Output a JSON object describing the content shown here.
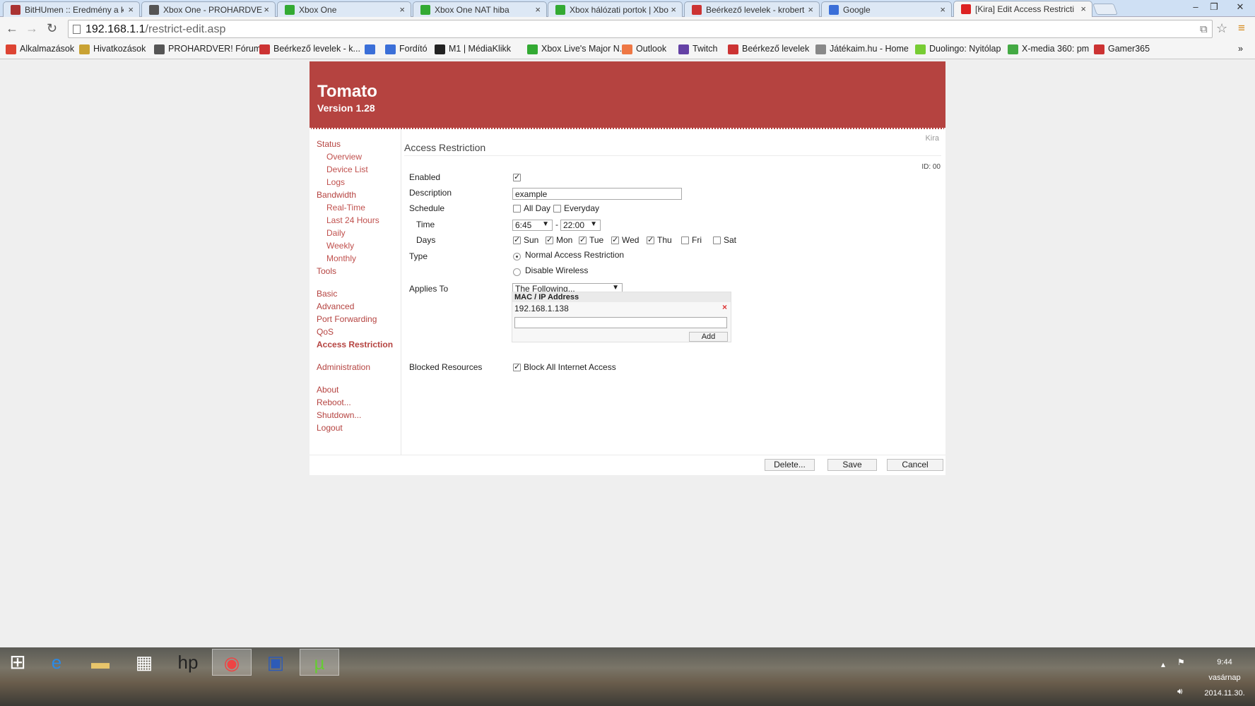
{
  "browser": {
    "tabs": [
      {
        "title": "BitHUmen :: Eredmény a k",
        "favicon": "bithumen-icon",
        "color": "#a33"
      },
      {
        "title": "Xbox One - PROHARDVER!",
        "favicon": "prohardver-icon",
        "color": "#555"
      },
      {
        "title": "Xbox One",
        "favicon": "xbox-icon",
        "color": "#3a3"
      },
      {
        "title": "Xbox One NAT hiba",
        "favicon": "xbox-icon",
        "color": "#3a3"
      },
      {
        "title": "Xbox hálózati portok | Xbo",
        "favicon": "xbox-icon",
        "color": "#3a3"
      },
      {
        "title": "Beérkező levelek - krobert",
        "favicon": "gmail-icon",
        "color": "#c33"
      },
      {
        "title": "Google",
        "favicon": "google-icon",
        "color": "#3b6fd8"
      },
      {
        "title": "[Kira] Edit Access Restricti",
        "favicon": "tomato-icon",
        "color": "#d22"
      }
    ],
    "address": {
      "host": "192.168.1.1",
      "path": "/restrict-edit.asp"
    },
    "bookmarks": [
      {
        "label": "Alkalmazások",
        "icon": "apps-grid-icon",
        "color": "#d43"
      },
      {
        "label": "Hivatkozások",
        "icon": "folder-icon",
        "color": "#c9a233"
      },
      {
        "label": "PROHARDVER! Fórum",
        "icon": "prohardver-icon",
        "color": "#555"
      },
      {
        "label": "Beérkező levelek - k...",
        "icon": "gmail-icon",
        "color": "#c33"
      },
      {
        "label": "",
        "icon": "google-icon",
        "color": "#3b6fd8"
      },
      {
        "label": "Fordító",
        "icon": "translate-icon",
        "color": "#3b6fd8"
      },
      {
        "label": "M1 | MédiaKlikk",
        "icon": "m1-icon",
        "color": "#222"
      },
      {
        "label": "Xbox Live's Major N...",
        "icon": "xbox-icon",
        "color": "#3a3"
      },
      {
        "label": "Outlook",
        "icon": "outlook-icon",
        "color": "#e74"
      },
      {
        "label": "Twitch",
        "icon": "twitch-icon",
        "color": "#6441a5"
      },
      {
        "label": "Beérkező levelek",
        "icon": "gmail-icon",
        "color": "#c33"
      },
      {
        "label": "Játékaim.hu - Home",
        "icon": "jatekaim-icon",
        "color": "#888"
      },
      {
        "label": "Duolingo: Nyitólap",
        "icon": "duolingo-icon",
        "color": "#7c3"
      },
      {
        "label": "X-media 360: pm",
        "icon": "xmedia-icon",
        "color": "#4a4"
      },
      {
        "label": "Gamer365",
        "icon": "gamer365-icon",
        "color": "#c33"
      }
    ]
  },
  "router": {
    "brand": "Tomato",
    "version": "Version 1.28",
    "accent": "#b54340",
    "username": "Kira",
    "nav": [
      {
        "label": "Status",
        "level": 0
      },
      {
        "label": "Overview",
        "level": 1
      },
      {
        "label": "Device List",
        "level": 1
      },
      {
        "label": "Logs",
        "level": 1
      },
      {
        "label": "Bandwidth",
        "level": 0
      },
      {
        "label": "Real-Time",
        "level": 1
      },
      {
        "label": "Last 24 Hours",
        "level": 1
      },
      {
        "label": "Daily",
        "level": 1
      },
      {
        "label": "Weekly",
        "level": 1
      },
      {
        "label": "Monthly",
        "level": 1
      },
      {
        "label": "Tools",
        "level": 0
      },
      {
        "label": "Basic",
        "level": 0
      },
      {
        "label": "Advanced",
        "level": 0
      },
      {
        "label": "Port Forwarding",
        "level": 0
      },
      {
        "label": "QoS",
        "level": 0
      },
      {
        "label": "Access Restriction",
        "level": 0,
        "active": true
      },
      {
        "label": "Administration",
        "level": 0
      },
      {
        "label": "About",
        "level": 0
      },
      {
        "label": "Reboot...",
        "level": 0
      },
      {
        "label": "Shutdown...",
        "level": 0
      },
      {
        "label": "Logout",
        "level": 0
      }
    ],
    "page_title": "Access Restriction",
    "id_label": "ID: 00",
    "form": {
      "enabled_label": "Enabled",
      "enabled": true,
      "description_label": "Description",
      "description_value": "example",
      "schedule_label": "Schedule",
      "all_day_label": "All Day",
      "all_day": false,
      "everyday_label": "Everyday",
      "everyday": false,
      "time_label": "Time",
      "time_from": "6:45",
      "time_sep": "-",
      "time_to": "22:00",
      "days_label": "Days",
      "days": [
        {
          "label": "Sun",
          "checked": true
        },
        {
          "label": "Mon",
          "checked": true
        },
        {
          "label": "Tue",
          "checked": true
        },
        {
          "label": "Wed",
          "checked": true
        },
        {
          "label": "Thu",
          "checked": true
        },
        {
          "label": "Fri",
          "checked": false
        },
        {
          "label": "Sat",
          "checked": false
        }
      ],
      "type_label": "Type",
      "type_normal_label": "Normal Access Restriction",
      "type_normal_selected": true,
      "type_wireless_label": "Disable Wireless",
      "type_wireless_selected": false,
      "applies_label": "Applies To",
      "applies_value": "The Following...",
      "mac_header": "MAC / IP Address",
      "mac_rows": [
        "192.168.1.138"
      ],
      "mac_delete_glyph": "×",
      "add_label": "Add",
      "blocked_label": "Blocked Resources",
      "block_all_label": "Block All Internet Access",
      "block_all": true
    },
    "buttons": {
      "delete": "Delete...",
      "save": "Save",
      "cancel": "Cancel"
    }
  },
  "taskbar": {
    "apps": [
      {
        "name": "internet-explorer-icon",
        "glyph": "e",
        "color": "#2b8ae6"
      },
      {
        "name": "file-explorer-icon",
        "glyph": "▬",
        "color": "#e8c56b"
      },
      {
        "name": "store-icon",
        "glyph": "▦",
        "color": "#fff"
      },
      {
        "name": "hp-icon",
        "glyph": "hp",
        "color": "#222"
      },
      {
        "name": "chrome-icon",
        "glyph": "◉",
        "color": "#e44",
        "active": true
      },
      {
        "name": "save-disk-icon",
        "glyph": "▣",
        "color": "#2d5bb7"
      },
      {
        "name": "utorrent-icon",
        "glyph": "µ",
        "color": "#6c3",
        "active": true
      }
    ],
    "time": "9:44",
    "day": "vasárnap",
    "date": "2014.11.30."
  }
}
